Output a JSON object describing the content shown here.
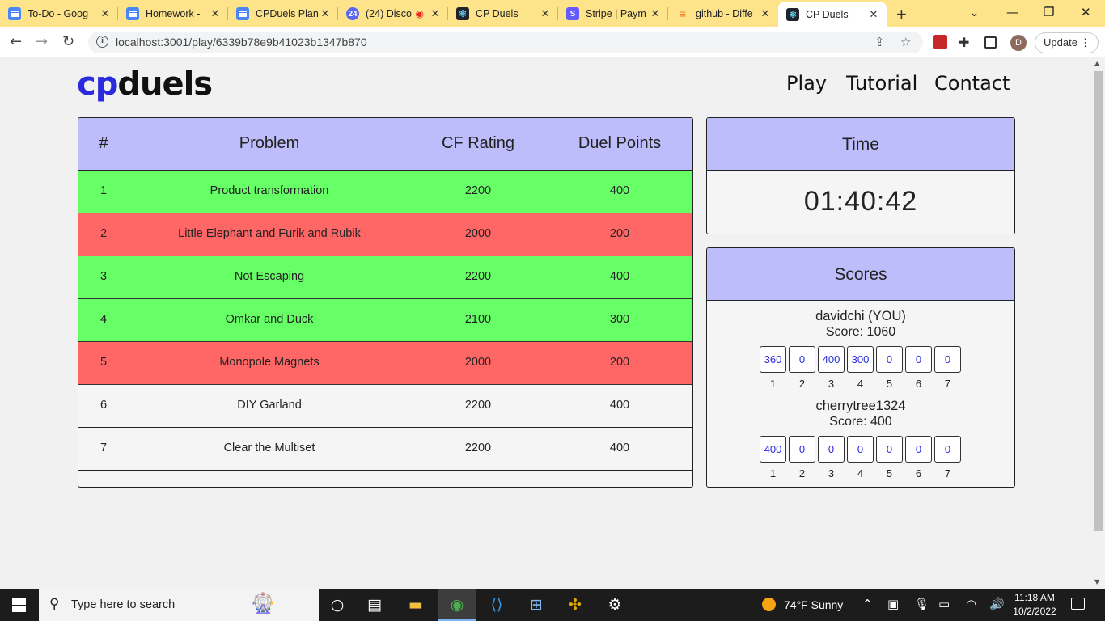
{
  "browser": {
    "tabs": [
      {
        "title": "To-Do - Goog",
        "icon": "google-docs-icon"
      },
      {
        "title": "Homework - ",
        "icon": "google-docs-icon"
      },
      {
        "title": "CPDuels Plan",
        "icon": "google-docs-icon"
      },
      {
        "title": "(24) Disco",
        "icon": "discord-icon",
        "badge": "24"
      },
      {
        "title": "CP Duels",
        "icon": "react-icon"
      },
      {
        "title": "Stripe | Paym",
        "icon": "stripe-icon"
      },
      {
        "title": "github - Diffe",
        "icon": "stackoverflow-icon"
      },
      {
        "title": "CP Duels",
        "icon": "react-icon",
        "active": true
      }
    ],
    "url": "localhost:3001/play/6339b78e9b41023b1347b870",
    "profile_initial": "D",
    "update_label": "Update"
  },
  "site": {
    "logo_cp": "cp",
    "logo_duels": "duels",
    "nav": [
      "Play",
      "Tutorial",
      "Contact"
    ]
  },
  "problems": {
    "headers": {
      "num": "#",
      "problem": "Problem",
      "rating": "CF Rating",
      "points": "Duel Points"
    },
    "rows": [
      {
        "num": "1",
        "name": "Product transformation",
        "rating": "2200",
        "points": "400",
        "status": "solved"
      },
      {
        "num": "2",
        "name": "Little Elephant and Furik and Rubik",
        "rating": "2000",
        "points": "200",
        "status": "failed"
      },
      {
        "num": "3",
        "name": "Not Escaping",
        "rating": "2200",
        "points": "400",
        "status": "solved"
      },
      {
        "num": "4",
        "name": "Omkar and Duck",
        "rating": "2100",
        "points": "300",
        "status": "solved"
      },
      {
        "num": "5",
        "name": "Monopole Magnets",
        "rating": "2000",
        "points": "200",
        "status": "failed"
      },
      {
        "num": "6",
        "name": "DIY Garland",
        "rating": "2200",
        "points": "400",
        "status": "open"
      },
      {
        "num": "7",
        "name": "Clear the Multiset",
        "rating": "2200",
        "points": "400",
        "status": "open"
      }
    ]
  },
  "time": {
    "title": "Time",
    "value": "01:40:42"
  },
  "scores": {
    "title": "Scores",
    "players": [
      {
        "name": "davidchi (YOU)",
        "score_text": "Score: 1060",
        "boxes": [
          "360",
          "0",
          "400",
          "300",
          "0",
          "0",
          "0"
        ],
        "labels": [
          "1",
          "2",
          "3",
          "4",
          "5",
          "6",
          "7"
        ]
      },
      {
        "name": "cherrytree1324",
        "score_text": "Score: 400",
        "boxes": [
          "400",
          "0",
          "0",
          "0",
          "0",
          "0",
          "0"
        ],
        "labels": [
          "1",
          "2",
          "3",
          "4",
          "5",
          "6",
          "7"
        ]
      }
    ]
  },
  "colors": {
    "solved": "#66ff66",
    "failed": "#ff6666",
    "header": "#bebdfb",
    "brand": "#2b2bdd"
  },
  "taskbar": {
    "search_placeholder": "Type here to search",
    "weather": "74°F  Sunny",
    "time": "11:18 AM",
    "date": "10/2/2022"
  }
}
